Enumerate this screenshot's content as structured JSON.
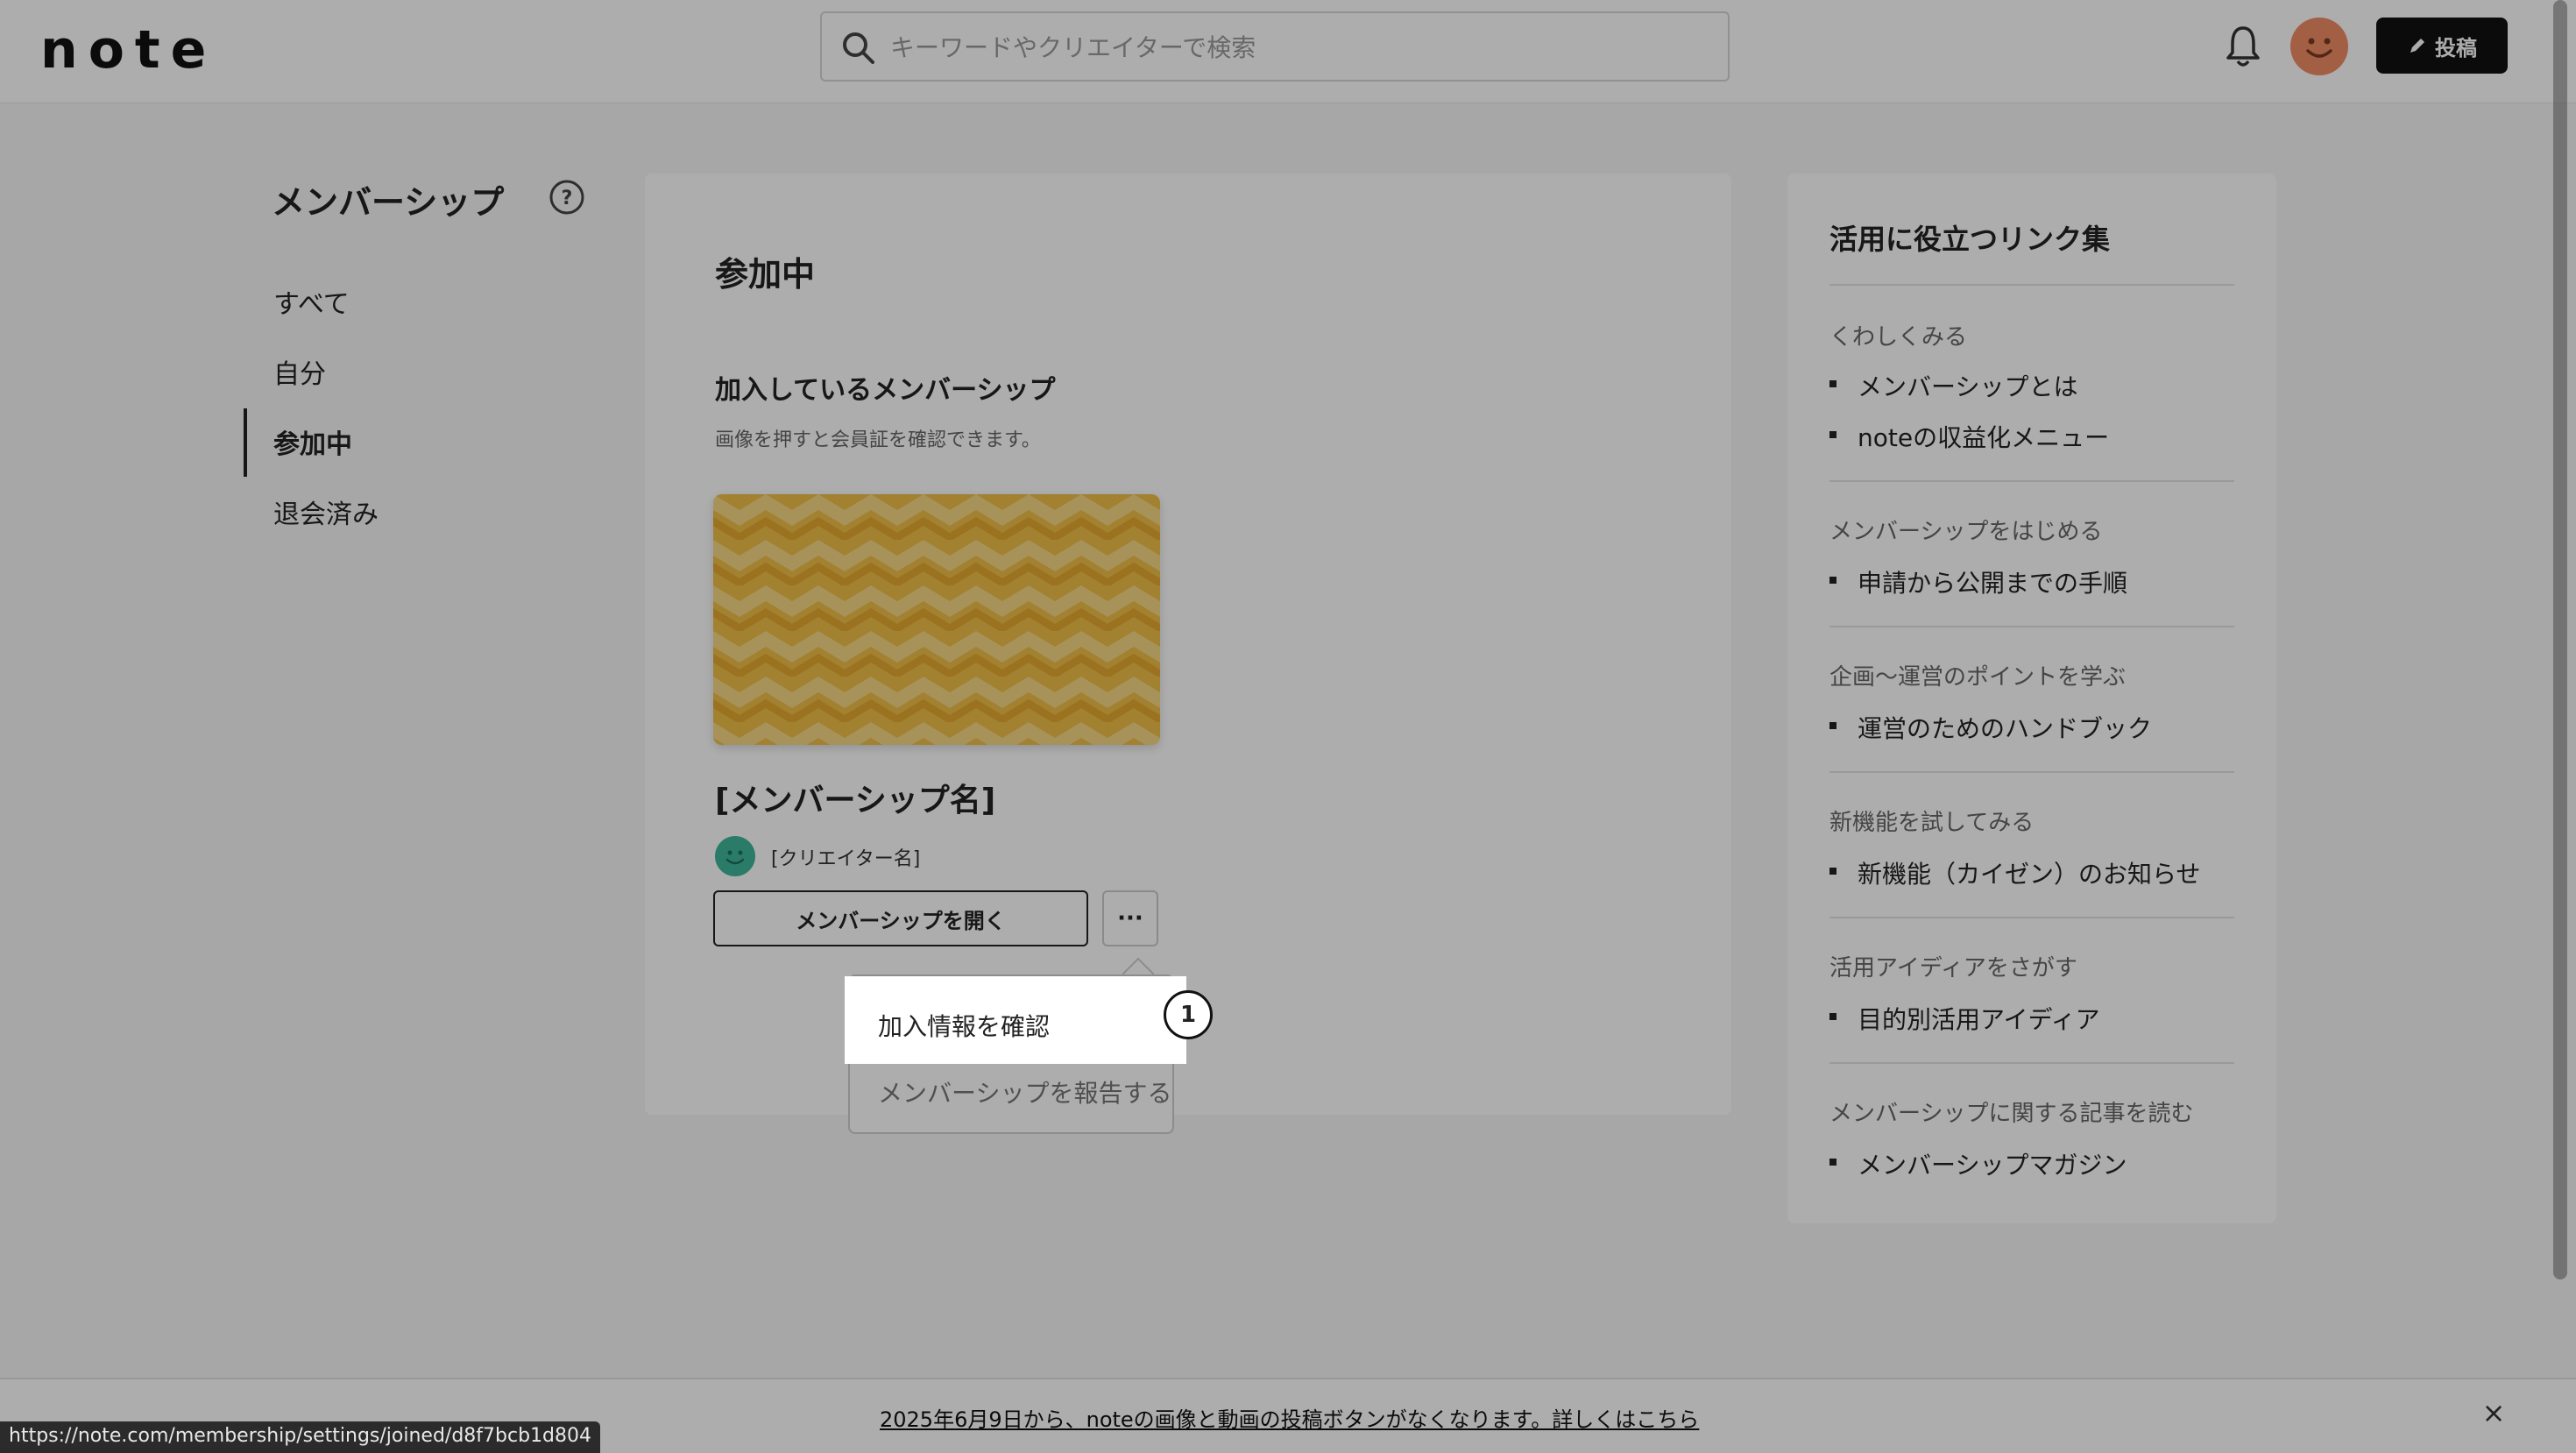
{
  "header": {
    "logo": "note",
    "search_placeholder": "キーワードやクリエイターで検索",
    "post_label": "投稿"
  },
  "sidebar": {
    "title": "メンバーシップ",
    "items": [
      {
        "label": "すべて"
      },
      {
        "label": "自分"
      },
      {
        "label": "参加中",
        "active": true
      },
      {
        "label": "退会済み"
      }
    ]
  },
  "main": {
    "title": "参加中",
    "section_title": "加入しているメンバーシップ",
    "section_desc": "画像を押すと会員証を確認できます。",
    "membership_name": "[メンバーシップ名]",
    "creator_name": "[クリエイター名]",
    "open_button": "メンバーシップを開く",
    "more_button": "···",
    "cover_color": "#efbf48"
  },
  "dropdown": {
    "items": [
      "加入情報を確認",
      "メンバーシップを報告する"
    ],
    "step": "1"
  },
  "links": {
    "title": "活用に役立つリンク集",
    "groups": [
      {
        "title": "くわしくみる",
        "items": [
          "メンバーシップとは",
          "noteの収益化メニュー"
        ]
      },
      {
        "title": "メンバーシップをはじめる",
        "items": [
          "申請から公開までの手順"
        ]
      },
      {
        "title": "企画〜運営のポイントを学ぶ",
        "items": [
          "運営のためのハンドブック"
        ]
      },
      {
        "title": "新機能を試してみる",
        "items": [
          "新機能（カイゼン）のお知らせ"
        ]
      },
      {
        "title": "活用アイディアをさがす",
        "items": [
          "目的別活用アイディア"
        ]
      },
      {
        "title": "メンバーシップに関する記事を読む",
        "items": [
          "メンバーシップマガジン"
        ]
      }
    ]
  },
  "footer": {
    "notice": "2025年6月9日から、noteの画像と動画の投稿ボタンがなくなります。詳しくはこちら",
    "close": "×",
    "status_url": "https://note.com/membership/settings/joined/d8f7bcb1d804"
  },
  "colors": {
    "accent": "#111111",
    "avatar": "#f08c65",
    "creator_avatar": "#3fb59a"
  }
}
